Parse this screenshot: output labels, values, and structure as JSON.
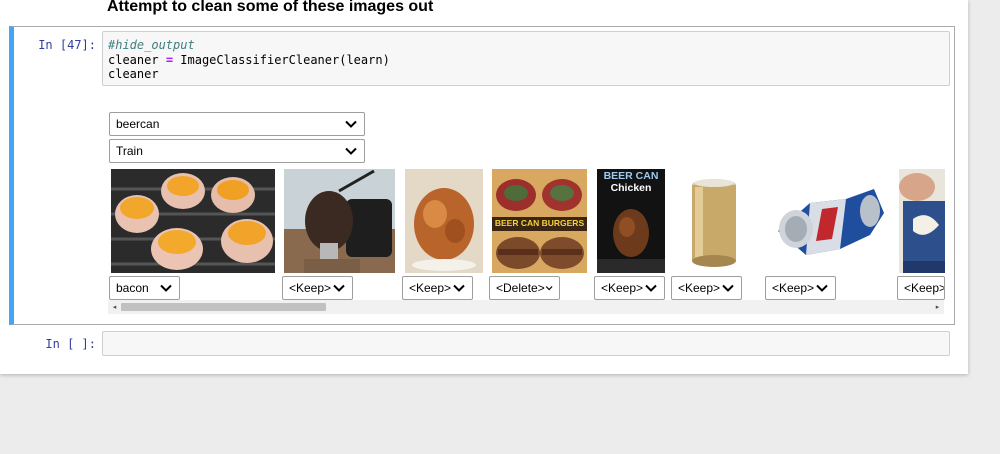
{
  "heading": "Attempt to clean some of these images out",
  "cell1": {
    "prompt": "In [47]:",
    "code": {
      "comment": "#hide_output",
      "line2_var": "cleaner",
      "line2_op": "=",
      "line2_call": "ImageClassifierCleaner(learn)",
      "line3": "cleaner"
    },
    "category_dropdown": "beercan",
    "split_dropdown": "Train",
    "images": [
      {
        "icon": "bacon-cups-image",
        "action": "bacon"
      },
      {
        "icon": "beer-can-chicken-grill-image",
        "action": "<Keep>"
      },
      {
        "icon": "roast-chicken-image",
        "action": "<Keep>"
      },
      {
        "icon": "beer-can-burgers-image",
        "caption": "BEER CAN BURGERS",
        "action": "<Delete>"
      },
      {
        "icon": "beer-can-chicken-poster-image",
        "caption_line1": "BEER CAN",
        "caption_line2": "Chicken",
        "action": "<Keep>"
      },
      {
        "icon": "gold-can-image",
        "action": "<Keep>"
      },
      {
        "icon": "crushed-can-image",
        "action": "<Keep>"
      },
      {
        "icon": "hand-can-image",
        "action": "<Keep>"
      }
    ],
    "scrollbar": {
      "left_arrow": "◂",
      "right_arrow": "▸"
    }
  },
  "cell2": {
    "prompt": "In [ ]:"
  },
  "colors": {
    "selected_cell_border": "#42a5f5",
    "prompt": "#303f9f",
    "comment": "#408080",
    "operator": "#aa22ff"
  }
}
